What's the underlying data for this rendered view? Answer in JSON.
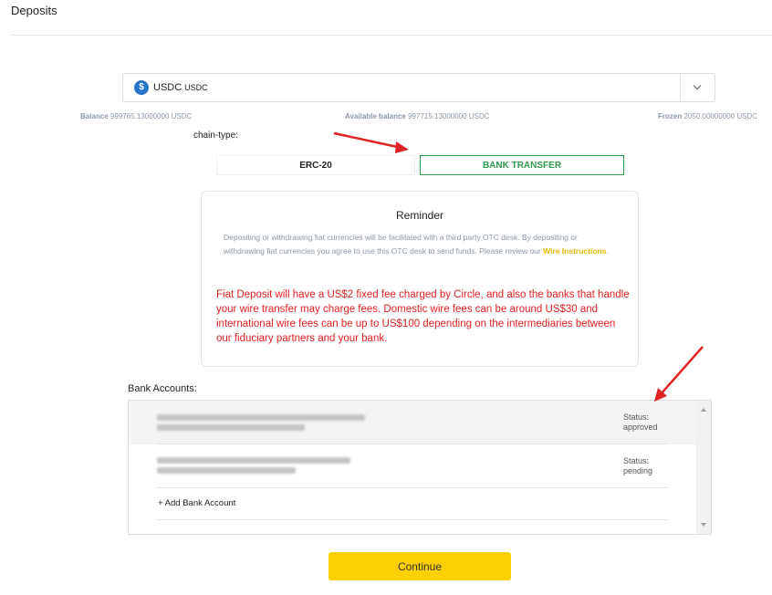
{
  "page": {
    "title": "Deposits"
  },
  "currency": {
    "icon": "usdc-coin-icon",
    "name": "USDC",
    "symbol": "USDC"
  },
  "balances": {
    "balance_label": "Balance",
    "balance_value": "999765.13000000 USDC",
    "available_label": "Available balance",
    "available_value": "997715.13000000 USDC",
    "frozen_label": "Frozen",
    "frozen_value": "2050.00000000 USDC"
  },
  "chain": {
    "label": "chain-type:",
    "tabs": [
      {
        "label": "ERC-20",
        "selected": false
      },
      {
        "label": "BANK TRANSFER",
        "selected": true
      }
    ]
  },
  "reminder": {
    "title": "Reminder",
    "text": "Depositing or withdrawing fiat currencies will be facilitated with a third party OTC desk. By depositing or withdrawing fiat currencies you agree to use this OTC desk to send funds. Please review our ",
    "link": "Wire Instructions",
    "text_end": ".",
    "fee_notice": "Fiat Deposit will have a US$2 fixed fee charged by Circle, and also the banks that handle your wire transfer may charge fees. Domestic wire fees can be around US$30 and international wire fees can be up to US$100 depending on the intermediaries between our fiduciary partners and your bank."
  },
  "bank_accounts": {
    "label": "Bank Accounts:",
    "items": [
      {
        "status": "Status: approved"
      },
      {
        "status": "Status: pending"
      }
    ],
    "add_label": "+ Add Bank Account"
  },
  "actions": {
    "continue_label": "Continue"
  },
  "colors": {
    "accent_green": "#2e9a4b",
    "button_yellow": "#fccf03",
    "link_yellow": "#e6b800",
    "warning_red": "#e02020",
    "arrow_red": "#e02424"
  }
}
